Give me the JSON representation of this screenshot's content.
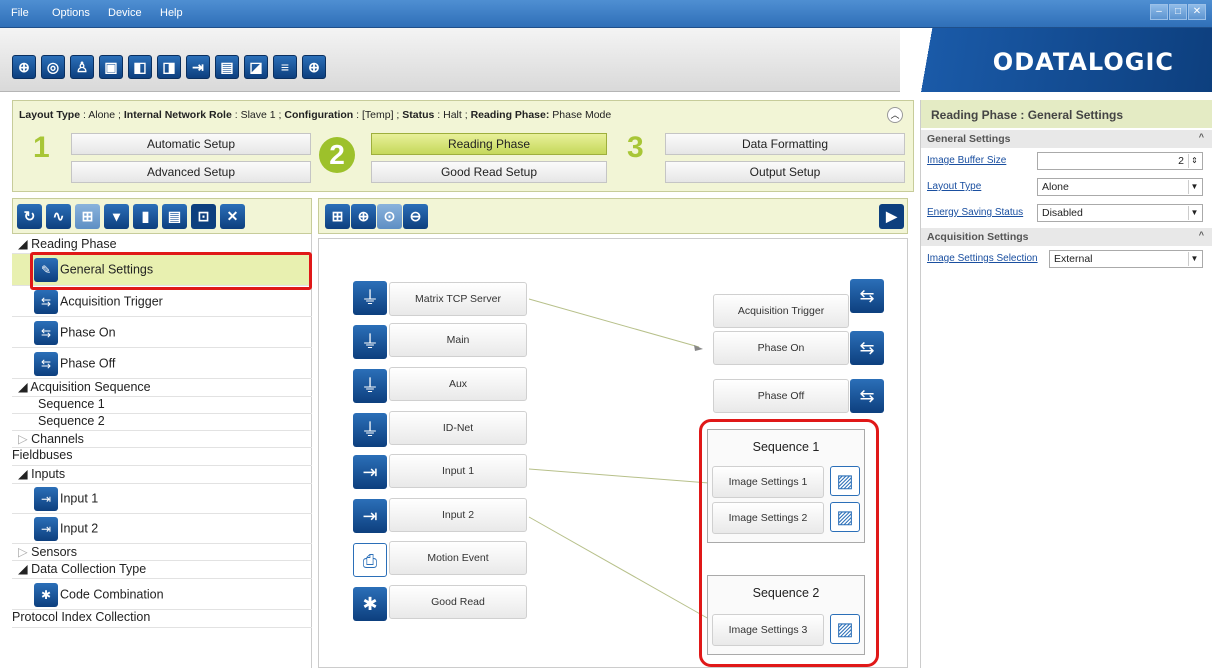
{
  "menu": [
    "File",
    "Options",
    "Device",
    "Help"
  ],
  "window_controls": [
    "–",
    "□",
    "✕"
  ],
  "toolbar_icons": [
    "connect-icon",
    "settings-icon",
    "user-icon",
    "window-icon",
    "capture-icon",
    "scan-icon",
    "export-icon",
    "monitor-icon",
    "image-icon",
    "statistics-icon",
    "target-icon"
  ],
  "brand": "ODATALOGIC",
  "status": {
    "layout_type_label": "Layout Type",
    "layout_type": "Alone",
    "network_role_label": "Internal Network Role",
    "network_role": "Slave 1",
    "configuration_label": "Configuration",
    "configuration": "[Temp]",
    "status_label": "Status",
    "status": "Halt",
    "reading_phase_label": "Reading Phase:",
    "reading_phase": "Phase Mode"
  },
  "wizard": {
    "step1": "1",
    "step2": "2",
    "step3": "3",
    "automatic_setup": "Automatic Setup",
    "advanced_setup": "Advanced Setup",
    "reading_phase": "Reading Phase",
    "good_read_setup": "Good Read Setup",
    "data_formatting": "Data Formatting",
    "output_setup": "Output Setup"
  },
  "props": {
    "title": "Reading Phase : General Settings",
    "general_section": "General Settings",
    "image_buffer_label": "Image Buffer Size",
    "image_buffer_value": "2",
    "layout_type_label": "Layout Type",
    "layout_type_value": "Alone",
    "energy_label": "Energy Saving Status",
    "energy_value": "Disabled",
    "acq_section": "Acquisition Settings",
    "image_settings_label": "Image Settings Selection",
    "image_settings_value": "External"
  },
  "tree": {
    "reading_phase": "Reading Phase",
    "general_settings": "General Settings",
    "acquisition_trigger": "Acquisition Trigger",
    "phase_on": "Phase On",
    "phase_off": "Phase Off",
    "acquisition_sequence": "Acquisition Sequence",
    "sequence1": "Sequence 1",
    "sequence2": "Sequence 2",
    "channels": "Channels",
    "fieldbuses": "Fieldbuses",
    "inputs": "Inputs",
    "input1": "Input 1",
    "input2": "Input 2",
    "sensors": "Sensors",
    "data_collection_type": "Data Collection Type",
    "code_combination": "Code Combination",
    "protocol_index": "Protocol Index Collection"
  },
  "canvas": {
    "sources": [
      "Matrix TCP Server",
      "Main",
      "Aux",
      "ID-Net",
      "Input 1",
      "Input 2",
      "Motion Event",
      "Good Read"
    ],
    "acquisition_trigger": "Acquisition Trigger",
    "phase_on": "Phase On",
    "phase_off": "Phase Off",
    "sequence1_title": "Sequence  1",
    "sequence2_title": "Sequence  2",
    "image_settings_1": "Image Settings  1",
    "image_settings_2": "Image Settings  2",
    "image_settings_3": "Image Settings  3"
  }
}
